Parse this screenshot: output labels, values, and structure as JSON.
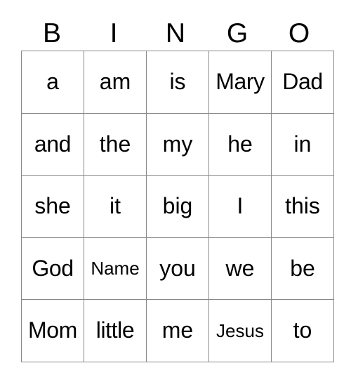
{
  "card": {
    "title": "BINGO",
    "header_letters": [
      "B",
      "I",
      "N",
      "G",
      "O"
    ],
    "columns": 5,
    "rows": 5,
    "border_color": "#888888",
    "text_color": "#000000",
    "background_color": "#ffffff",
    "grid": [
      [
        {
          "text": "a",
          "fit": "normal"
        },
        {
          "text": "am",
          "fit": "normal"
        },
        {
          "text": "is",
          "fit": "normal"
        },
        {
          "text": "Mary",
          "fit": "snug"
        },
        {
          "text": "Dad",
          "fit": "snug"
        }
      ],
      [
        {
          "text": "and",
          "fit": "snug"
        },
        {
          "text": "the",
          "fit": "normal"
        },
        {
          "text": "my",
          "fit": "normal"
        },
        {
          "text": "he",
          "fit": "normal"
        },
        {
          "text": "in",
          "fit": "normal"
        }
      ],
      [
        {
          "text": "she",
          "fit": "normal"
        },
        {
          "text": "it",
          "fit": "normal"
        },
        {
          "text": "big",
          "fit": "normal"
        },
        {
          "text": "I",
          "fit": "normal"
        },
        {
          "text": "this",
          "fit": "normal"
        }
      ],
      [
        {
          "text": "God",
          "fit": "snug"
        },
        {
          "text": "Name",
          "fit": "small"
        },
        {
          "text": "you",
          "fit": "normal"
        },
        {
          "text": "we",
          "fit": "normal"
        },
        {
          "text": "be",
          "fit": "normal"
        }
      ],
      [
        {
          "text": "Mom",
          "fit": "snug"
        },
        {
          "text": "little",
          "fit": "snug"
        },
        {
          "text": "me",
          "fit": "normal"
        },
        {
          "text": "Jesus",
          "fit": "small"
        },
        {
          "text": "to",
          "fit": "normal"
        }
      ]
    ]
  }
}
